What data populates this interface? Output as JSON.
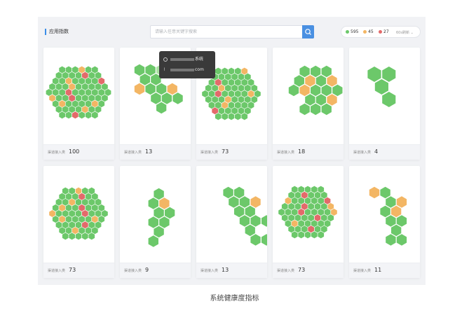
{
  "header": {
    "title": "应用指数",
    "search_placeholder": "请输入任意关键字搜索"
  },
  "legend": {
    "green_count": "595",
    "orange_count": "45",
    "red_count": "27",
    "refresh": "60s刷新"
  },
  "colors": {
    "green": "#6cc86a",
    "light_green": "#a9e2a2",
    "orange": "#f3b664",
    "red": "#e36a6a",
    "accent": "#4a90e2"
  },
  "tooltip": {
    "row1_suffix": "系统",
    "row2_suffix": "com"
  },
  "card_label": "渠道接入类",
  "cards": [
    {
      "value": "100"
    },
    {
      "value": "13"
    },
    {
      "value": "73"
    },
    {
      "value": "18"
    },
    {
      "value": "4"
    },
    {
      "value": "73"
    },
    {
      "value": "9"
    },
    {
      "value": "13"
    },
    {
      "value": "73"
    },
    {
      "value": "11"
    }
  ],
  "caption": "系统健康度指标"
}
